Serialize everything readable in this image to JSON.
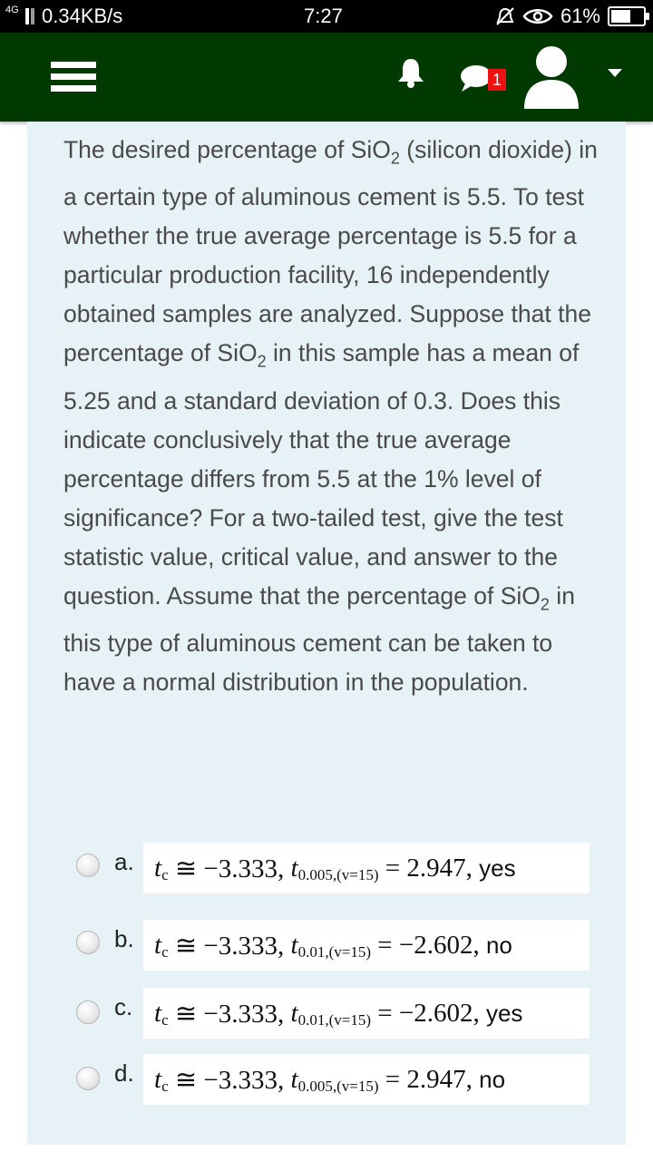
{
  "status_bar": {
    "network": "4G",
    "speed": "0.34KB/s",
    "time": "7:27",
    "battery": "61%",
    "battery_fraction": 0.61
  },
  "header": {
    "notification_badge": "1",
    "background_color": "#003a00"
  },
  "question": {
    "parts": [
      "The desired percentage of SiO",
      "2",
      " (silicon dioxide) in a certain type of aluminous cement is 5.5. To test whether the true average percentage is 5.5 for a particular production facility, 16 independently obtained samples are analyzed. Suppose that the percentage of SiO",
      "2",
      " in this sample has a mean of 5.25 and a standard deviation of 0.3. Does this indicate conclusively that the true average percentage differs from 5.5 at the 1% level of significance? For a two-tailed test, give the test statistic value, critical value, and answer to the question. Assume that the percentage of SiO",
      "2",
      " in this type of aluminous cement can be taken to have a normal distribution in the population."
    ]
  },
  "options": [
    {
      "letter": "a.",
      "tc": "t",
      "tc_sub": "c",
      "approx": " ≅ −3.333, ",
      "t": "t",
      "t_sub": "0.005,(v=15)",
      "eq": " = 2.947, ",
      "answer": "yes"
    },
    {
      "letter": "b.",
      "tc": "t",
      "tc_sub": "c",
      "approx": " ≅ −3.333, ",
      "t": "t",
      "t_sub": "0.01,(v=15)",
      "eq": " = −2.602, ",
      "answer": "no"
    },
    {
      "letter": "c.",
      "tc": "t",
      "tc_sub": "c",
      "approx": " ≅ −3.333, ",
      "t": "t",
      "t_sub": "0.01,(v=15)",
      "eq": " = −2.602, ",
      "answer": "yes"
    },
    {
      "letter": "d.",
      "tc": "t",
      "tc_sub": "c",
      "approx": " ≅ −3.333, ",
      "t": "t",
      "t_sub": "0.005,(v=15)",
      "eq": " = 2.947, ",
      "answer": "no"
    }
  ]
}
